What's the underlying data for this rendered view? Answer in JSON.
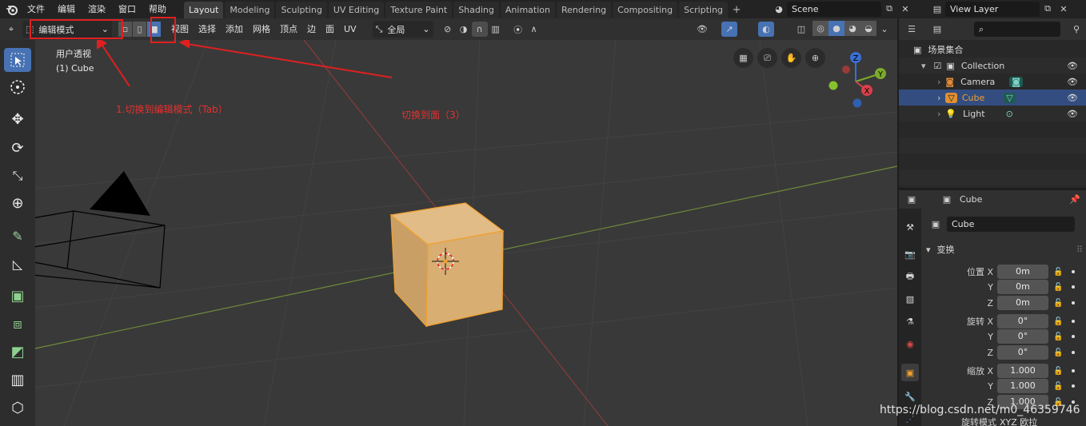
{
  "topbar": {
    "menus": [
      "文件",
      "编辑",
      "渲染",
      "窗口",
      "帮助"
    ],
    "workspaces": [
      "Layout",
      "Modeling",
      "Sculpting",
      "UV Editing",
      "Texture Paint",
      "Shading",
      "Animation",
      "Rendering",
      "Compositing",
      "Scripting"
    ],
    "active_workspace": "Layout",
    "add_tab": "+",
    "scene": "Scene",
    "view_layer": "View Layer"
  },
  "viewport_header": {
    "mode": "编辑模式",
    "menus": [
      "视图",
      "选择",
      "添加",
      "网格",
      "顶点",
      "边",
      "面",
      "UV"
    ],
    "transform_orientation": "全局"
  },
  "viewport": {
    "perspective_label": "用户透视",
    "object_label": "(1) Cube",
    "gizmo_axes": {
      "z": "Z",
      "y": "Y",
      "x": "X"
    }
  },
  "annotations": {
    "step1": "1.切换到编辑模式（Tab）",
    "step2": "切换到面（3）",
    "color": "#e63030"
  },
  "outliner": {
    "root": "场景集合",
    "items": [
      {
        "name": "Collection"
      },
      {
        "name": "Camera"
      },
      {
        "name": "Cube"
      },
      {
        "name": "Light"
      }
    ]
  },
  "properties": {
    "header_object": "Cube",
    "name_field": "Cube",
    "panel_title": "变换",
    "location": {
      "label": "位置 X",
      "x": "0m",
      "y": "0m",
      "z": "0m"
    },
    "rotation": {
      "label": "旋转 X",
      "x": "0°",
      "y": "0°",
      "z": "0°"
    },
    "scale": {
      "label": "缩放 X",
      "x": "1.000",
      "y": "1.000",
      "z": "1.000"
    },
    "axis_y": "Y",
    "axis_z": "Z",
    "rotation_mode_label": "旋转模式",
    "rotation_mode_value": "XYZ 欧拉"
  },
  "watermark": "https://blog.csdn.net/m0_46359746",
  "colors": {
    "accent": "#4772b3",
    "cube": "#d9b27a",
    "selected_orange": "#f0a030"
  }
}
